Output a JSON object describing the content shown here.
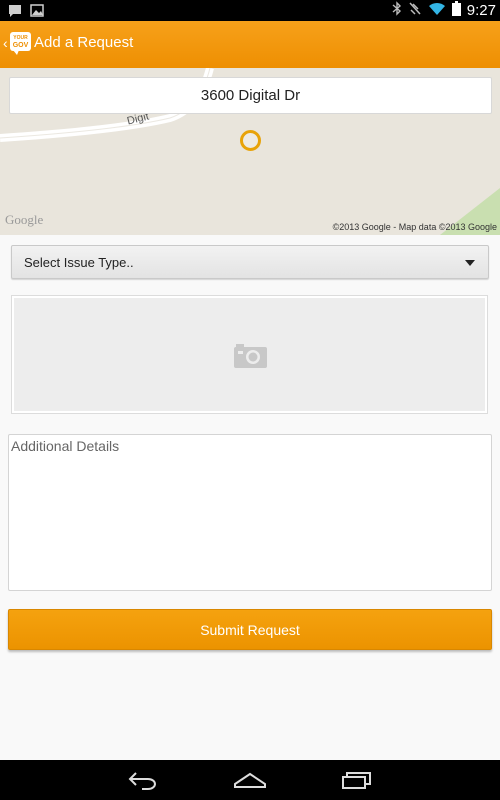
{
  "status_bar": {
    "time": "9:27",
    "left_icons": [
      "chat-notification-icon",
      "image-notification-icon"
    ],
    "right_icons": [
      "bluetooth-icon",
      "vibrate-icon",
      "wifi-icon",
      "battery-icon"
    ]
  },
  "action_bar": {
    "title": "Add a Request",
    "logo_text_top": "YOUR",
    "logo_text_bottom": "GOV",
    "colors": {
      "accent": "#F29A0C"
    }
  },
  "map": {
    "address": "3600 Digital Dr",
    "road_label": "Digit",
    "provider_logo": "Google",
    "copyright": "©2013 Google - Map data ©2013 Google"
  },
  "form": {
    "issue_type_label": "Select Issue Type..",
    "photo_icon": "camera-icon",
    "details_placeholder": "Additional Details",
    "submit_label": "Submit Request"
  },
  "nav_bar": {
    "buttons": [
      "back-icon",
      "home-icon",
      "recents-icon"
    ]
  }
}
